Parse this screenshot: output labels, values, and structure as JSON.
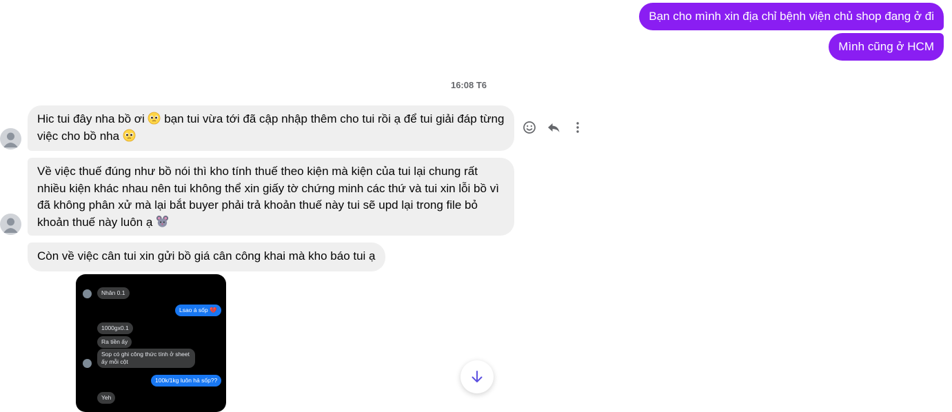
{
  "messages_out": [
    {
      "text": "Bạn cho mình xin địa chỉ bệnh viện chủ shop đang ở đi"
    },
    {
      "text": "Mình cũng ở HCM"
    }
  ],
  "timestamp": "16:08 T6",
  "messages_in": {
    "m1_part1": "Hic tui đây nha bồ ơi ",
    "m1_part2": " bạn tui vừa tới đã cập nhập thêm cho tui rồi ạ để tui giải đáp từng việc cho bồ nha ",
    "m2": "Về việc thuế đúng như bồ nói thì kho tính thuế theo kiện mà kiện của tui lại chung rất nhiều kiện khác nhau nên tui không thể xin giấy tờ chứng minh các thứ và tui xin lỗi bồ vì đã không phân xử mà lại bắt buyer phải trả khoản thuế này tui sẽ upd lại trong file bỏ khoản thuế này luôn ạ ",
    "m3": "Còn về việc cân tui xin gửi bồ giá cân công khai mà kho báo tui ạ"
  },
  "emoji_icons": [
    "pleading-face-icon",
    "pleading-face-icon",
    "mouse-face-icon"
  ],
  "actions": [
    "react-icon",
    "reply-icon",
    "more-icon"
  ],
  "image_chat": {
    "msg1": "Nhân 0.1",
    "msg2": "Lsao á sốp 💔",
    "msg3": "1000gx0.1",
    "msg4": "Ra tiền ấy",
    "msg5": "Sop có ghi công thức tính ở sheet ấy mỗi cột",
    "msg6": "100k/1kg luôn hả sốp??",
    "msg7": "Yeh"
  },
  "colors": {
    "outgoing": "#8a1ef2",
    "incoming": "#efefef",
    "image_out": "#1877f2"
  }
}
